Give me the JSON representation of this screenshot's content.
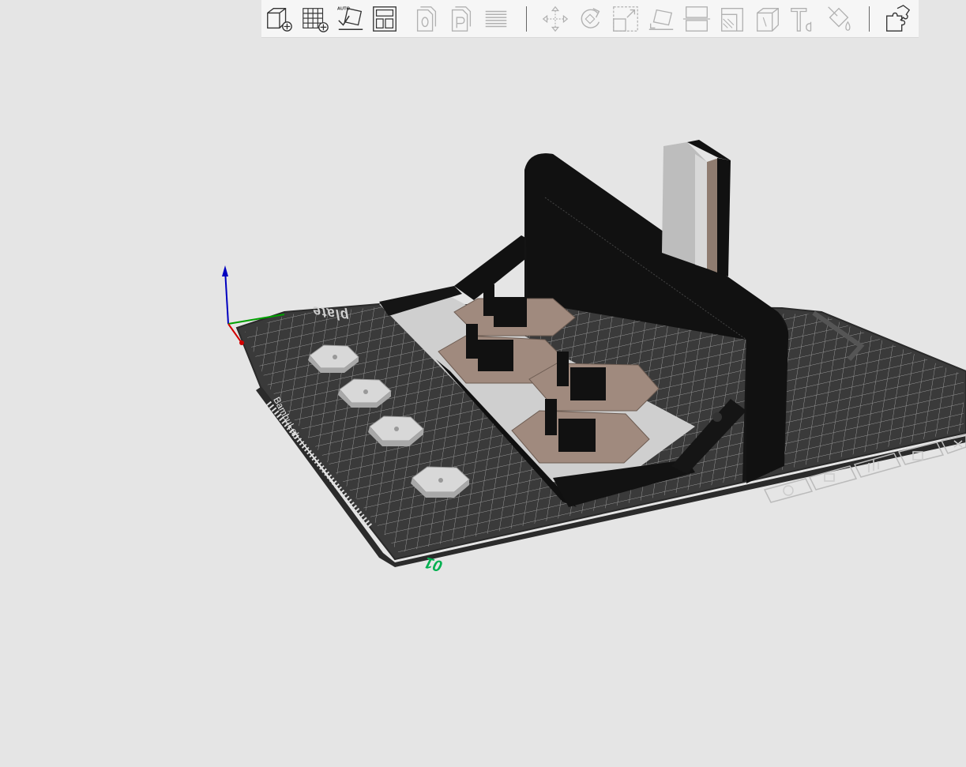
{
  "toolbar": {
    "tools": [
      {
        "name": "add-object",
        "icon": "cube-plus-icon",
        "enabled": true
      },
      {
        "name": "add-plate",
        "icon": "grid-plus-icon",
        "enabled": true
      },
      {
        "name": "auto-orient",
        "icon": "auto-orient-icon",
        "badge": "AUTO",
        "enabled": true
      },
      {
        "name": "arrange",
        "icon": "arrange-icon",
        "enabled": true
      },
      {
        "name": "copy",
        "icon": "copy-icon",
        "enabled": false
      },
      {
        "name": "paste",
        "icon": "paste-icon",
        "enabled": false
      },
      {
        "name": "layers",
        "icon": "layers-icon",
        "enabled": false
      },
      {
        "name": "move",
        "icon": "move-icon",
        "enabled": false
      },
      {
        "name": "rotate",
        "icon": "rotate-icon",
        "enabled": false
      },
      {
        "name": "scale",
        "icon": "scale-icon",
        "enabled": false
      },
      {
        "name": "lay-on-face",
        "icon": "lay-on-face-icon",
        "enabled": false
      },
      {
        "name": "cut",
        "icon": "cut-icon",
        "enabled": false
      },
      {
        "name": "support-paint",
        "icon": "support-paint-icon",
        "enabled": false
      },
      {
        "name": "seam-paint",
        "icon": "seam-paint-icon",
        "enabled": false
      },
      {
        "name": "text",
        "icon": "text-icon",
        "enabled": false
      },
      {
        "name": "color-paint",
        "icon": "paint-bucket-icon",
        "enabled": false
      },
      {
        "name": "assembly",
        "icon": "puzzle-icon",
        "enabled": true
      }
    ]
  },
  "plate": {
    "label": "plate",
    "brand": "BambuLab",
    "number": "01",
    "colors": {
      "bed": "#3b3b3b",
      "grid": "#8a8a8a",
      "number": "#00b050"
    },
    "icons": [
      "settings-icon",
      "orient-icon",
      "arrange-icon",
      "lock-icon",
      "close-icon"
    ]
  },
  "axes": {
    "x_color": "#d10000",
    "y_color": "#00a000",
    "z_color": "#0000c0"
  },
  "models": {
    "colors": {
      "black": "#121212",
      "tan": "#a08a7e",
      "light": "#c8c8c8",
      "white": "#d8d8d8"
    }
  }
}
